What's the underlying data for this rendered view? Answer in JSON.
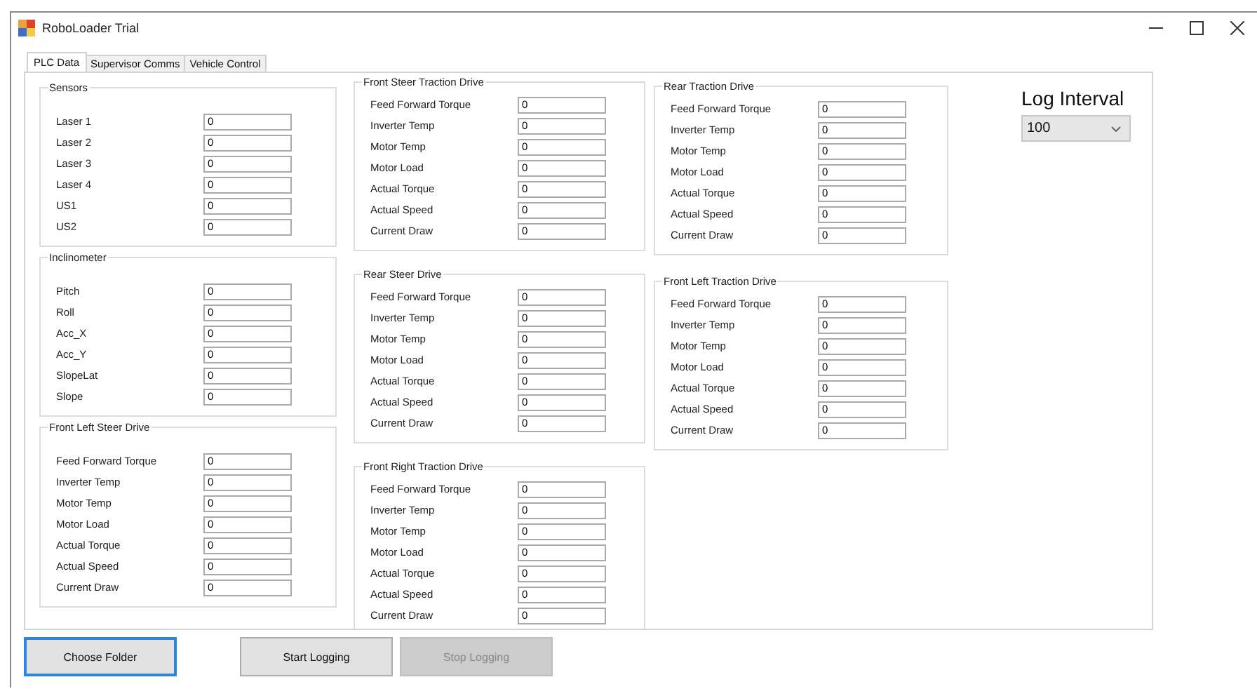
{
  "window": {
    "title": "RoboLoader Trial"
  },
  "tabs": [
    {
      "label": "PLC Data",
      "selected": true
    },
    {
      "label": "Supervisor Comms",
      "selected": false
    },
    {
      "label": "Vehicle Control",
      "selected": false
    }
  ],
  "columns": [
    {
      "groups": [
        {
          "title": "Sensors",
          "fields": [
            {
              "label": "Laser 1",
              "value": "0"
            },
            {
              "label": "Laser 2",
              "value": "0"
            },
            {
              "label": "Laser 3",
              "value": "0"
            },
            {
              "label": "Laser 4",
              "value": "0"
            },
            {
              "label": "US1",
              "value": "0"
            },
            {
              "label": "US2",
              "value": "0"
            }
          ]
        },
        {
          "title": "Inclinometer",
          "fields": [
            {
              "label": "Pitch",
              "value": "0"
            },
            {
              "label": "Roll",
              "value": "0"
            },
            {
              "label": "Acc_X",
              "value": "0"
            },
            {
              "label": "Acc_Y",
              "value": "0"
            },
            {
              "label": "SlopeLat",
              "value": "0"
            },
            {
              "label": "Slope",
              "value": "0"
            }
          ]
        },
        {
          "title": "Front Left Steer Drive",
          "fields": [
            {
              "label": "Feed Forward Torque",
              "value": "0"
            },
            {
              "label": "Inverter Temp",
              "value": "0"
            },
            {
              "label": "Motor Temp",
              "value": "0"
            },
            {
              "label": "Motor Load",
              "value": "0"
            },
            {
              "label": "Actual Torque",
              "value": "0"
            },
            {
              "label": "Actual Speed",
              "value": "0"
            },
            {
              "label": "Current Draw",
              "value": "0"
            }
          ]
        }
      ]
    },
    {
      "groups": [
        {
          "title": "Front Steer Traction Drive",
          "fields": [
            {
              "label": "Feed Forward Torque",
              "value": "0"
            },
            {
              "label": "Inverter Temp",
              "value": "0"
            },
            {
              "label": "Motor Temp",
              "value": "0"
            },
            {
              "label": "Motor Load",
              "value": "0"
            },
            {
              "label": "Actual Torque",
              "value": "0"
            },
            {
              "label": "Actual Speed",
              "value": "0"
            },
            {
              "label": "Current Draw",
              "value": "0"
            }
          ]
        },
        {
          "title": "Rear Steer Drive",
          "fields": [
            {
              "label": "Feed Forward Torque",
              "value": "0"
            },
            {
              "label": "Inverter Temp",
              "value": "0"
            },
            {
              "label": "Motor Temp",
              "value": "0"
            },
            {
              "label": "Motor Load",
              "value": "0"
            },
            {
              "label": "Actual Torque",
              "value": "0"
            },
            {
              "label": "Actual Speed",
              "value": "0"
            },
            {
              "label": "Current Draw",
              "value": "0"
            }
          ]
        },
        {
          "title": "Front Right Traction Drive",
          "fields": [
            {
              "label": "Feed Forward Torque",
              "value": "0"
            },
            {
              "label": "Inverter Temp",
              "value": "0"
            },
            {
              "label": "Motor Temp",
              "value": "0"
            },
            {
              "label": "Motor Load",
              "value": "0"
            },
            {
              "label": "Actual Torque",
              "value": "0"
            },
            {
              "label": "Actual Speed",
              "value": "0"
            },
            {
              "label": "Current Draw",
              "value": "0"
            }
          ]
        }
      ]
    },
    {
      "groups": [
        {
          "title": "Rear Traction Drive",
          "fields": [
            {
              "label": "Feed Forward Torque",
              "value": "0"
            },
            {
              "label": "Inverter Temp",
              "value": "0"
            },
            {
              "label": "Motor Temp",
              "value": "0"
            },
            {
              "label": "Motor Load",
              "value": "0"
            },
            {
              "label": "Actual Torque",
              "value": "0"
            },
            {
              "label": "Actual Speed",
              "value": "0"
            },
            {
              "label": "Current Draw",
              "value": "0"
            }
          ]
        },
        {
          "title": "Front Left Traction Drive",
          "fields": [
            {
              "label": "Feed Forward Torque",
              "value": "0"
            },
            {
              "label": "Inverter Temp",
              "value": "0"
            },
            {
              "label": "Motor Temp",
              "value": "0"
            },
            {
              "label": "Motor Load",
              "value": "0"
            },
            {
              "label": "Actual Torque",
              "value": "0"
            },
            {
              "label": "Actual Speed",
              "value": "0"
            },
            {
              "label": "Current Draw",
              "value": "0"
            }
          ]
        }
      ]
    }
  ],
  "log_interval": {
    "label": "Log Interval",
    "value": "100"
  },
  "buttons": [
    {
      "label": "Choose Folder",
      "focused": true,
      "disabled": false
    },
    {
      "label": "Start Logging",
      "focused": false,
      "disabled": false
    },
    {
      "label": "Stop Logging",
      "focused": false,
      "disabled": true
    }
  ]
}
